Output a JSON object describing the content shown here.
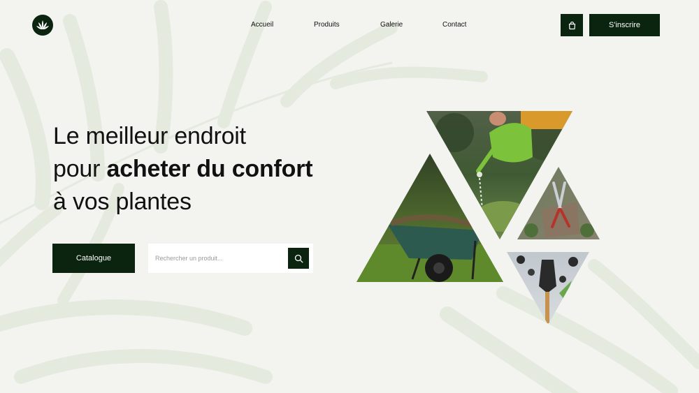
{
  "brand": {
    "logo_icon": "leaf-logo-icon"
  },
  "nav": {
    "items": [
      {
        "label": "Accueil"
      },
      {
        "label": "Produits"
      },
      {
        "label": "Galerie"
      },
      {
        "label": "Contact"
      }
    ]
  },
  "header": {
    "cart_icon": "shopping-bag-icon",
    "signup_label": "S'inscrire"
  },
  "hero": {
    "line1": "Le meilleur endroit",
    "line2_prefix": "pour ",
    "line2_bold": "acheter du confort",
    "line3": "à vos plantes",
    "catalogue_label": "Catalogue",
    "search_placeholder": "Rechercher un produit...",
    "search_icon": "search-icon"
  },
  "collage": {
    "images": [
      {
        "name": "watering-can-photo"
      },
      {
        "name": "wheelbarrow-photo"
      },
      {
        "name": "pruning-shears-photo"
      },
      {
        "name": "garden-trowel-photo"
      }
    ]
  },
  "colors": {
    "accent": "#0b2410",
    "background": "#f3f3f0",
    "button_text": "#ffffff"
  }
}
